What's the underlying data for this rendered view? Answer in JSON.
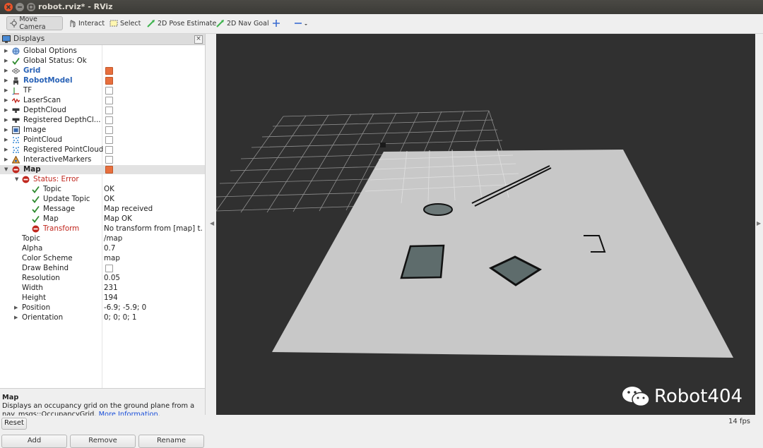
{
  "window": {
    "title": "robot.rviz* - RViz"
  },
  "toolbar": {
    "move_camera": "Move Camera",
    "interact": "Interact",
    "select": "Select",
    "pose_estimate": "2D Pose Estimate",
    "nav_goal": "2D Nav Goal"
  },
  "displays": {
    "title": "Displays",
    "rows": [
      {
        "label": "Global Options"
      },
      {
        "label": "Global Status: Ok"
      },
      {
        "label": "Grid",
        "checked": true
      },
      {
        "label": "RobotModel",
        "checked": true
      },
      {
        "label": "TF",
        "checked": false
      },
      {
        "label": "LaserScan",
        "checked": false
      },
      {
        "label": "DepthCloud",
        "checked": false
      },
      {
        "label": "Registered DepthCl...",
        "checked": false
      },
      {
        "label": "Image",
        "checked": false
      },
      {
        "label": "PointCloud",
        "checked": false
      },
      {
        "label": "Registered PointCloud",
        "checked": false
      },
      {
        "label": "InteractiveMarkers",
        "checked": false
      },
      {
        "label": "Map",
        "checked": true
      },
      {
        "label": "Status: Error"
      },
      {
        "label": "Topic",
        "value": "OK"
      },
      {
        "label": "Update Topic",
        "value": "OK"
      },
      {
        "label": "Message",
        "value": "Map received"
      },
      {
        "label": "Map",
        "value": "Map OK"
      },
      {
        "label": "Transform",
        "value": "No transform from [map] t..."
      },
      {
        "label": "Topic",
        "value": "/map"
      },
      {
        "label": "Alpha",
        "value": "0.7"
      },
      {
        "label": "Color Scheme",
        "value": "map"
      },
      {
        "label": "Draw Behind",
        "checked": false
      },
      {
        "label": "Resolution",
        "value": "0.05"
      },
      {
        "label": "Width",
        "value": "231"
      },
      {
        "label": "Height",
        "value": "194"
      },
      {
        "label": "Position",
        "value": "-6.9; -5.9; 0"
      },
      {
        "label": "Orientation",
        "value": "0; 0; 0; 1"
      }
    ]
  },
  "description": {
    "title": "Map",
    "text": "Displays an occupancy grid on the ground plane from a nav_msgs::OccupancyGrid.",
    "link": "More Information",
    "suffix": "."
  },
  "buttons": {
    "add": "Add",
    "remove": "Remove",
    "rename": "Rename"
  },
  "status": {
    "reset": "Reset",
    "fps": "14 fps"
  },
  "watermark": "Robot404",
  "colors": {
    "error": "#c0271e",
    "ok": "#2e8b2e",
    "checkbox_on": "#e86f3d",
    "link": "#1a4fd8"
  }
}
